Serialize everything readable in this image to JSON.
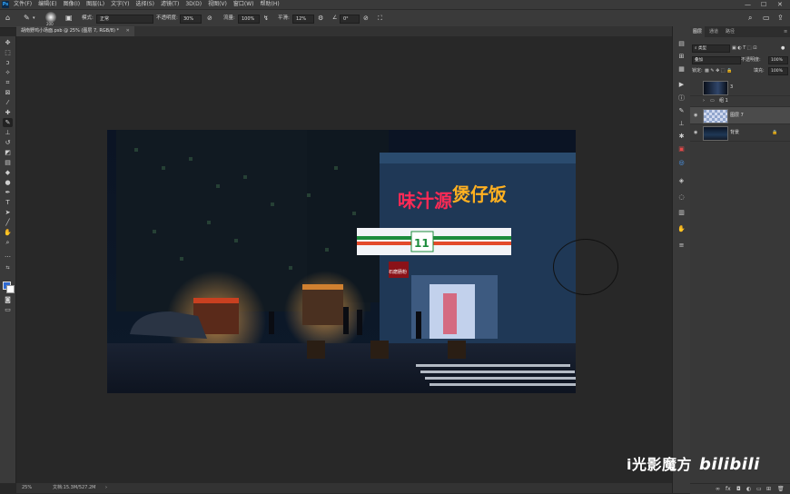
{
  "menubar": {
    "logo": "Ps",
    "items": [
      "文件(F)",
      "编辑(E)",
      "图像(I)",
      "图层(L)",
      "文字(Y)",
      "选择(S)",
      "滤镜(T)",
      "3D(D)",
      "视图(V)",
      "窗口(W)",
      "帮助(H)"
    ],
    "min": "—",
    "max": "☐",
    "close": "✕"
  },
  "options": {
    "brush_size": "200",
    "mode_label": "模式:",
    "mode_value": "正常",
    "opacity_label": "不透明度:",
    "opacity_value": "30%",
    "flow_label": "流量:",
    "flow_value": "100%",
    "smooth_label": "平滑:",
    "smooth_value": "12%",
    "angle_value": "0°"
  },
  "document": {
    "tab_title": "胡南野鸡小场面.psb @ 25% (图层 7, RGB/8) *",
    "close": "✕"
  },
  "status": {
    "zoom": "25%",
    "doc_info": "文档:15.3M/527.2M"
  },
  "photo": {
    "sign_main": "味汁源",
    "sign_sub": "煲仔饭",
    "store_logo": "11",
    "small_sign": "石磨肠粉"
  },
  "panel": {
    "tabs": [
      "图层",
      "通道",
      "路径"
    ],
    "kind_label": "类型",
    "blend_mode": "叠加",
    "opacity_label": "不透明度:",
    "opacity_value": "100%",
    "lock_label": "锁定:",
    "fill_label": "填充:",
    "fill_value": "100%",
    "layers": [
      {
        "name": "3",
        "type": "layer"
      },
      {
        "name": "组 1",
        "type": "group"
      },
      {
        "name": "图层 7",
        "type": "layer",
        "active": true
      },
      {
        "name": "背景",
        "type": "background",
        "locked": true
      }
    ]
  },
  "watermark": {
    "text": "i光影魔方",
    "bili": "bilibili"
  },
  "colors": {
    "foreground": "#2f6ad1",
    "background": "#ffffff",
    "ui_dark": "#282828",
    "panel": "#383838"
  }
}
